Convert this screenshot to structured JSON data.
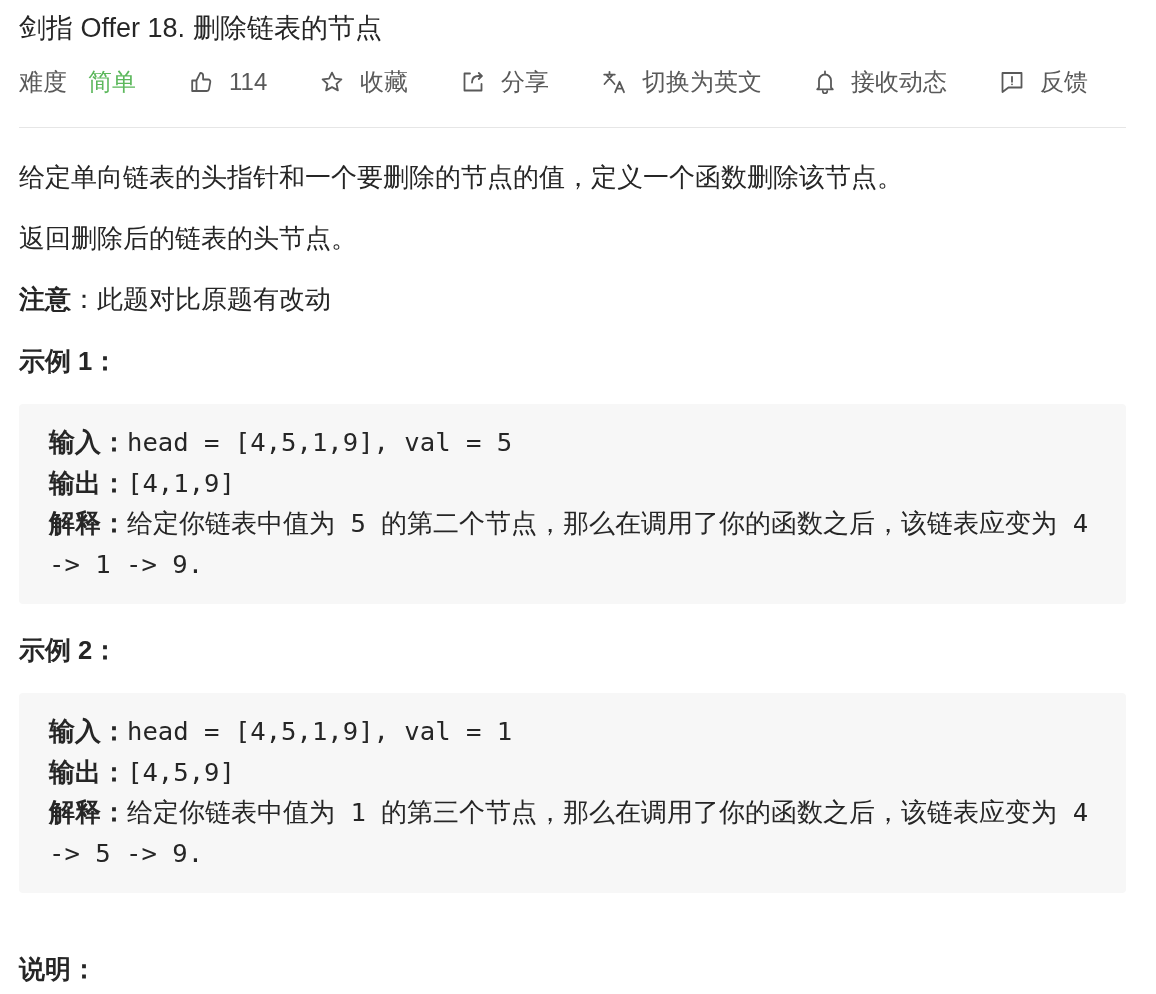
{
  "title": "剑指 Offer 18. 删除链表的节点",
  "difficulty": {
    "label": "难度",
    "value": "简单"
  },
  "actions": [
    {
      "kind": "like",
      "label": "114"
    },
    {
      "kind": "favorite",
      "label": "收藏"
    },
    {
      "kind": "share",
      "label": "分享"
    },
    {
      "kind": "translate",
      "label": "切换为英文"
    },
    {
      "kind": "subscribe",
      "label": "接收动态"
    },
    {
      "kind": "feedback",
      "label": "反馈"
    }
  ],
  "content": [
    {
      "kind": "paragraph",
      "text": "给定单向链表的头指针和一个要删除的节点的值，定义一个函数删除该节点。"
    },
    {
      "kind": "paragraph",
      "text": "返回删除后的链表的头节点。"
    },
    {
      "kind": "paragraph",
      "text": "**注意**：此题对比原题有改动"
    },
    {
      "kind": "heading",
      "text": "示例 1："
    },
    {
      "kind": "example",
      "lines": [
        "**输入：**head = [4,5,1,9], val = 5",
        "**输出：**[4,1,9]",
        "**解释：**给定你链表中值为 5 的第二个节点，那么在调用了你的函数之后，该链表应变为 4 -> 1 -> 9."
      ]
    },
    {
      "kind": "heading",
      "text": "示例 2："
    },
    {
      "kind": "example",
      "lines": [
        "**输入：**head = [4,5,1,9], val = 1",
        "**输出：**[4,5,9]",
        "**解释：**给定你链表中值为 1 的第三个节点，那么在调用了你的函数之后，该链表应变为 4 -> 5 -> 9."
      ]
    },
    {
      "kind": "heading",
      "text": "说明："
    }
  ]
}
